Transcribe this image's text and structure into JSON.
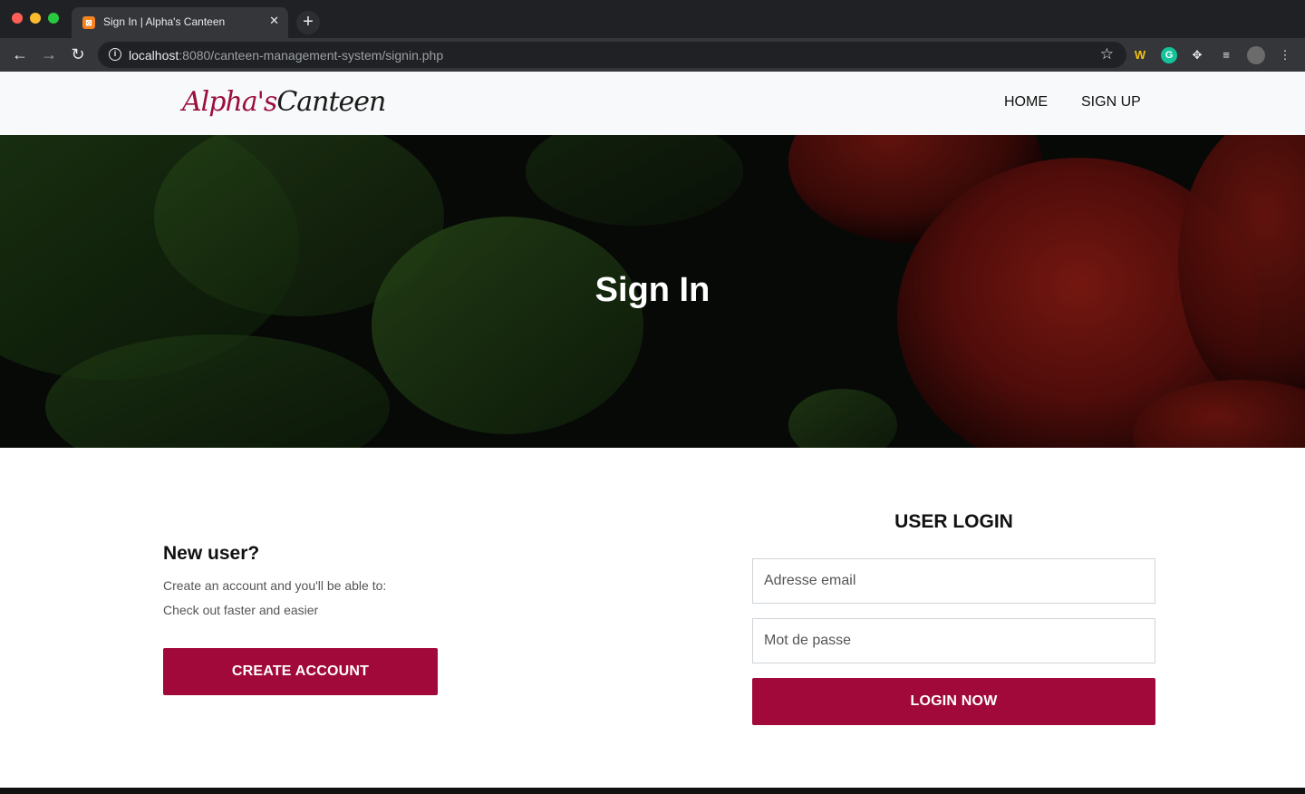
{
  "browser": {
    "tab_title": "Sign In | Alpha's Canteen",
    "url_host": "localhost",
    "url_rest": ":8080/canteen-management-system/signin.php"
  },
  "header": {
    "logo_part1": "Alpha's",
    "logo_part2": "Canteen",
    "nav": [
      "HOME",
      "SIGN UP"
    ]
  },
  "hero": {
    "title": "Sign In"
  },
  "new_user": {
    "title": "New user?",
    "line1": "Create an account and you'll be able to:",
    "line2": "Check out faster and easier",
    "button": "CREATE ACCOUNT"
  },
  "login": {
    "title": "USER LOGIN",
    "email_placeholder": "Adresse email",
    "password_placeholder": "Mot de passe",
    "button": "LOGIN NOW"
  },
  "colors": {
    "accent": "#a0093a",
    "header_bg": "#f8f9fa"
  }
}
